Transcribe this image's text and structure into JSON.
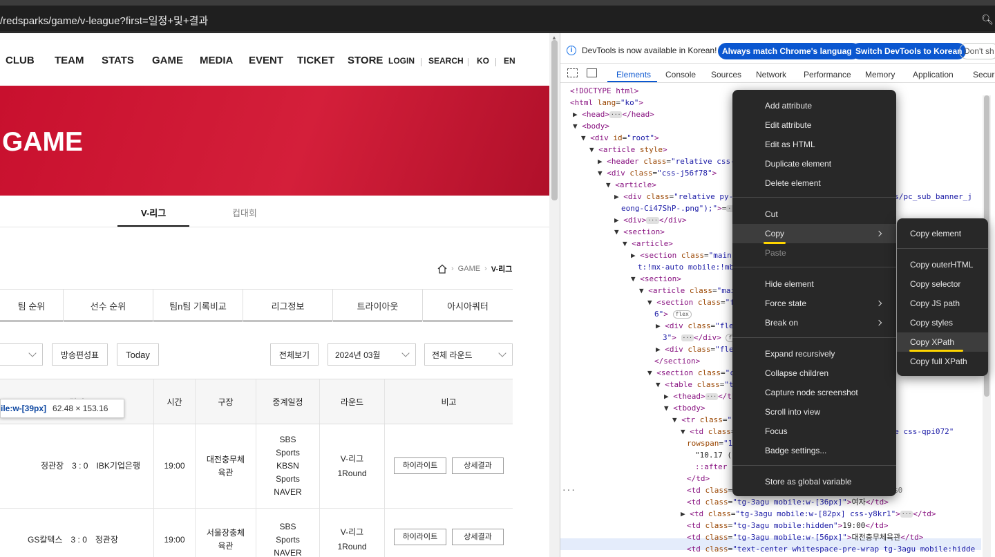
{
  "browser": {
    "url": "/redsparks/game/v-league?first=일정+및+결과",
    "zoom_icon": "zoom-icon"
  },
  "site": {
    "nav": [
      "CLUB",
      "TEAM",
      "STATS",
      "GAME",
      "MEDIA",
      "EVENT",
      "TICKET",
      "STORE"
    ],
    "util": [
      "LOGIN",
      "SEARCH",
      "KO",
      "EN"
    ],
    "banner_title": "GAME",
    "league_tabs": [
      "V-리그",
      "컵대회"
    ],
    "breadcrumb": [
      "GAME",
      "V-리그"
    ],
    "subtabs": [
      "팀 순위",
      "선수 순위",
      "팀n팀 기록비교",
      "리그정보",
      "트라이아웃",
      "아시아쿼터"
    ],
    "filters": {
      "broadcast": "방송편성표",
      "today": "Today",
      "all": "전체보기",
      "month": "2024년 03월",
      "round": "전체 라운드"
    },
    "table": {
      "headers": [
        "시간",
        "구장",
        "중계일정",
        "라운드",
        "비고"
      ],
      "partial_header": "경기",
      "rows": [
        {
          "match_home": "정관장",
          "score": "3 : 0",
          "match_away": "IBK기업은행",
          "time": "19:00",
          "venue": "대전충무체\n육관",
          "broadcast": "SBS\nSports\nKBSN\nSports\nNAVER",
          "round": "V-리그\n1Round",
          "highlight": "하이라이트",
          "detail": "상세결과"
        },
        {
          "match_home": "GS칼텍스",
          "score": "3 : 0",
          "match_away": "정관장",
          "time": "19:00",
          "venue": "서울장충체\n육관",
          "broadcast": "SBS\nSports\nNAVER",
          "round": "V-리그\n1Round",
          "highlight": "하이라이트",
          "detail": "상세결과"
        }
      ]
    },
    "tooltip": {
      "selector": "ile:w-[39px]",
      "size": "62.48 × 153.16"
    }
  },
  "devtools": {
    "info": "DevTools is now available in Korean!",
    "btn_match": "Always match Chrome's language",
    "btn_switch": "Switch DevTools to Korean",
    "btn_dont": "Don't sh",
    "tabs": [
      "Elements",
      "Console",
      "Sources",
      "Network",
      "Performance",
      "Memory",
      "Application",
      "Securi"
    ]
  },
  "context_menu": {
    "items": [
      "Add attribute",
      "Edit attribute",
      "Edit as HTML",
      "Duplicate element",
      "Delete element",
      "Cut",
      "Copy",
      "Paste",
      "Hide element",
      "Force state",
      "Break on",
      "Expand recursively",
      "Collapse children",
      "Capture node screenshot",
      "Scroll into view",
      "Focus",
      "Badge settings...",
      "Store as global variable"
    ]
  },
  "copy_submenu": {
    "items": [
      "Copy element",
      "Copy outerHTML",
      "Copy selector",
      "Copy JS path",
      "Copy styles",
      "Copy XPath",
      "Copy full XPath"
    ]
  },
  "colors": {
    "brand_red": "#c8102e",
    "devtools_blue": "#0b57d0",
    "marker_yellow": "#ffd500"
  }
}
